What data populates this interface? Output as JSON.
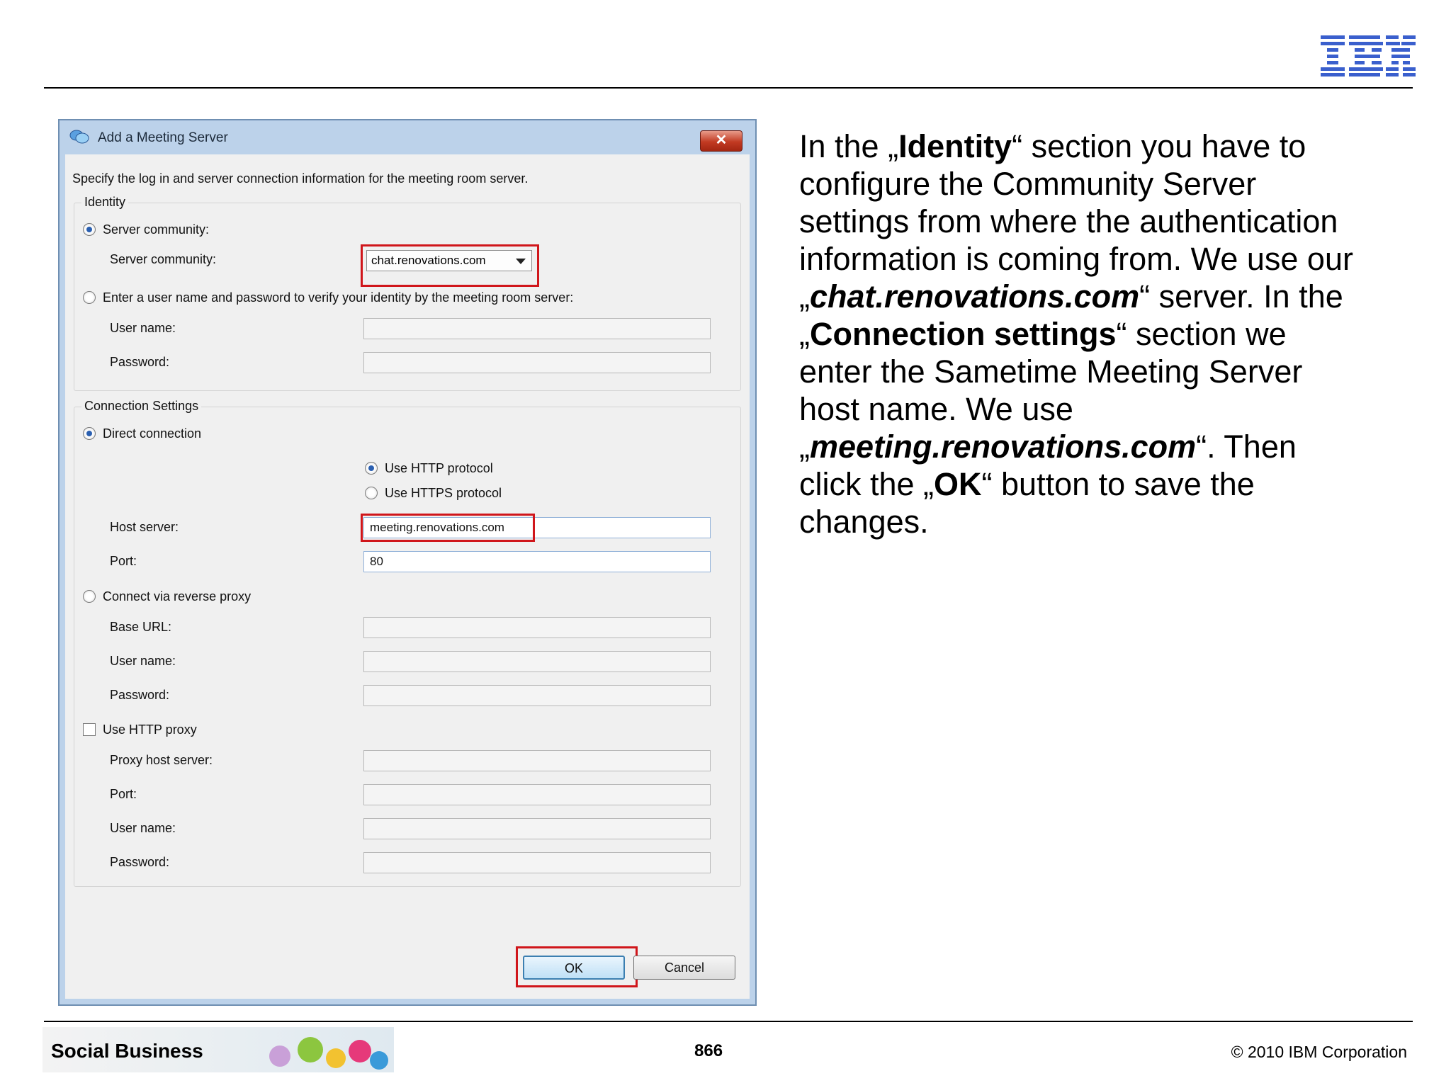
{
  "header": {
    "logo_text": "IBM"
  },
  "dialog": {
    "title": "Add a Meeting Server",
    "close_label": "✕",
    "intro": "Specify the log in and server connection information for the meeting room server.",
    "identity": {
      "legend": "Identity",
      "server_community_radio": "Server community:",
      "server_community_label": "Server community:",
      "server_community_value": "chat.renovations.com",
      "userpass_radio": "Enter a user name and password to verify your identity by the meeting room server:",
      "user_name_label": "User name:",
      "user_name_value": "",
      "password_label": "Password:",
      "password_value": ""
    },
    "connection": {
      "legend": "Connection Settings",
      "direct_radio": "Direct connection",
      "http_radio": "Use HTTP protocol",
      "https_radio": "Use HTTPS protocol",
      "host_label": "Host server:",
      "host_value": "meeting.renovations.com",
      "port_label": "Port:",
      "port_value": "80",
      "reverse_proxy_radio": "Connect via reverse proxy",
      "base_url_label": "Base URL:",
      "rp_user_label": "User name:",
      "rp_password_label": "Password:",
      "http_proxy_check": "Use HTTP proxy",
      "proxy_host_label": "Proxy host server:",
      "proxy_port_label": "Port:",
      "proxy_user_label": "User name:",
      "proxy_password_label": "Password:"
    },
    "ok_label": "OK",
    "cancel_label": "Cancel"
  },
  "explanation": {
    "p1": "In the „",
    "identity": "Identity",
    "p2": "“ section you have to configure the Community Server settings from where the authentication information is coming from. We use our „",
    "chat": "chat.renovations.com",
    "p3": "“ server. In the „",
    "conn": "Connection settings",
    "p4": "“ section we enter the Sametime Meeting Server host name. We use „",
    "meeting": "meeting.renovations.com",
    "p5": "“. Then click the „",
    "ok": "OK",
    "p6": "“ button to save the changes."
  },
  "footer": {
    "brand": "Social Business",
    "page_number": "866",
    "copyright": "© 2010 IBM Corporation"
  },
  "colors": {
    "highlight": "#d0161b",
    "ibm_blue": "#3a5fcd",
    "dialog_frame": "#bcd2ea"
  }
}
